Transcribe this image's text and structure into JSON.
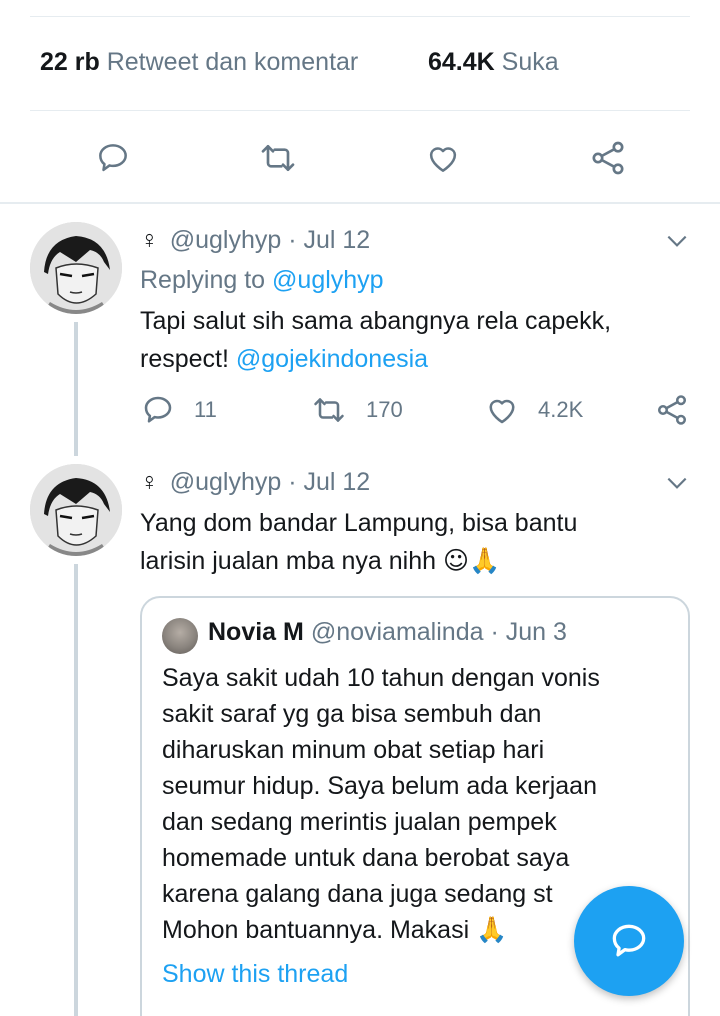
{
  "stats": {
    "retweets_count": "22 rb",
    "retweets_label": "Retweet dan komentar",
    "likes_count": "64.4K",
    "likes_label": "Suka"
  },
  "action_bar": {
    "icons": [
      "reply-icon",
      "retweet-icon",
      "like-icon",
      "share-icon"
    ]
  },
  "tweets": [
    {
      "symbol": "♀",
      "handle": "@uglyhyp",
      "sep": "·",
      "date": "Jul 12",
      "replying_prefix": "Replying to",
      "replying_handle": "@uglyhyp",
      "text_line1": "Tapi salut sih sama abangnya rela capekk,",
      "text_line2_prefix": "respect!",
      "text_mention": "@gojekindonesia",
      "reply_count": "11",
      "retweet_count": "170",
      "like_count": "4.2K"
    },
    {
      "symbol": "♀",
      "handle": "@uglyhyp",
      "sep": "·",
      "date": "Jul 12",
      "text_line1": "Yang dom bandar Lampung, bisa bantu",
      "text_line2": "larisin jualan mba nya nihh",
      "text_emoji": "☺🙏"
    }
  ],
  "quote": {
    "name": "Novia M",
    "handle": "@noviamalinda",
    "sep": "·",
    "date": "Jun 3",
    "lines": [
      "Saya sakit udah 10 tahun dengan vonis",
      "sakit saraf yg ga bisa sembuh dan",
      "diharuskan minum obat setiap hari",
      "seumur hidup. Saya belum ada kerjaan",
      "dan sedang merintis jualan pempek",
      "homemade untuk dana berobat saya",
      "karena galang dana juga sedang st",
      "Mohon bantuannya. Makasi"
    ],
    "emoji": "🙏",
    "show_thread": "Show this thread"
  },
  "colors": {
    "accent": "#1da1f2",
    "muted": "#657786",
    "text": "#14171a",
    "border": "#ccd6dd"
  }
}
